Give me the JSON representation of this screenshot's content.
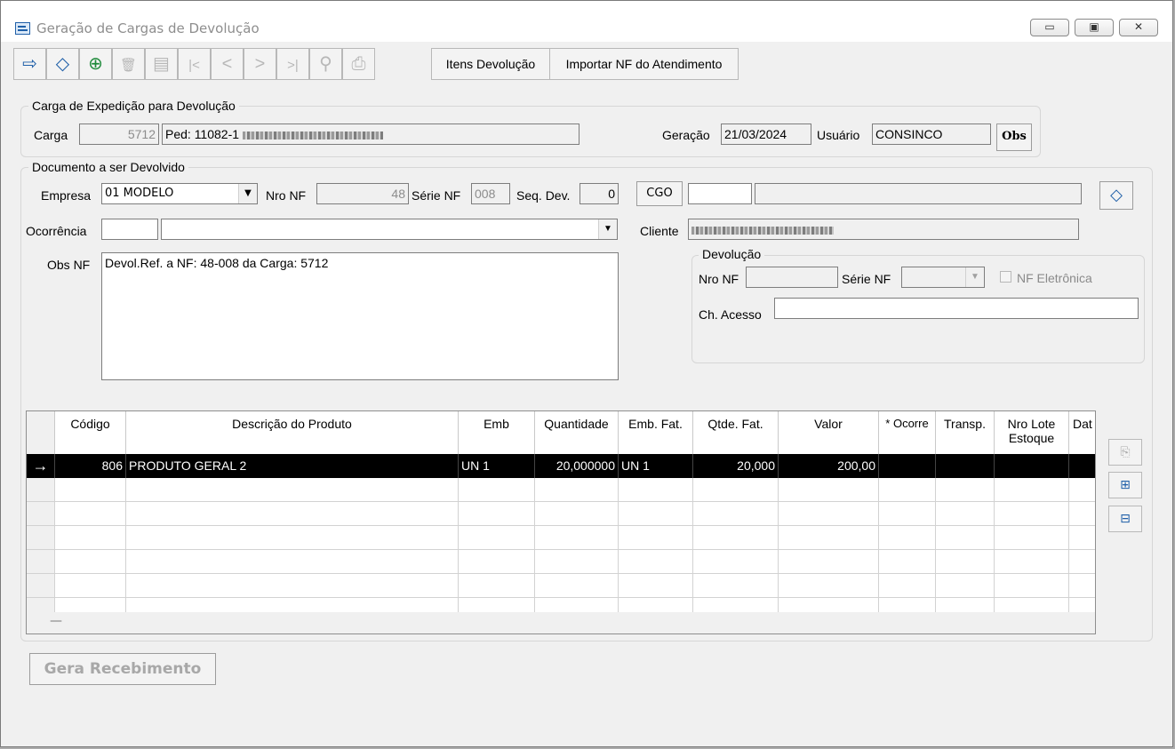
{
  "window": {
    "title": "Geração de Cargas de Devolução",
    "controls": [
      "▭",
      "▣",
      "✕"
    ]
  },
  "toolbar": {
    "icons": [
      {
        "name": "exit-icon",
        "glyph": "⇨",
        "enabled": true,
        "color": "#1f5fa8"
      },
      {
        "name": "eraser-icon",
        "glyph": "◇",
        "enabled": true,
        "color": "#1f5fa8"
      },
      {
        "name": "add-icon",
        "glyph": "⊕",
        "enabled": true,
        "color": "#1e8a3a"
      },
      {
        "name": "delete-icon",
        "glyph": "🗑",
        "enabled": false,
        "color": "#b7b7b7"
      },
      {
        "name": "save-icon",
        "glyph": "▤",
        "enabled": false,
        "color": "#b7b7b7"
      },
      {
        "name": "first-icon",
        "glyph": "|<",
        "enabled": false,
        "color": "#b7b7b7"
      },
      {
        "name": "previous-icon",
        "glyph": "<",
        "enabled": false,
        "color": "#b7b7b7"
      },
      {
        "name": "next-icon",
        "glyph": ">",
        "enabled": false,
        "color": "#b7b7b7"
      },
      {
        "name": "last-icon",
        "glyph": ">|",
        "enabled": false,
        "color": "#b7b7b7"
      },
      {
        "name": "search-icon",
        "glyph": "⚲",
        "enabled": false,
        "color": "#b7b7b7"
      },
      {
        "name": "print-icon",
        "glyph": "⎙",
        "enabled": false,
        "color": "#b7b7b7"
      }
    ],
    "itens_label": "Itens Devolução",
    "importar_label": "Importar NF do Atendimento"
  },
  "carga_group": {
    "label": "Carga de Expedição para Devolução",
    "carga_label": "Carga",
    "carga_value": "5712",
    "ped_value": "Ped: 11082-1",
    "geracao_label": "Geração",
    "geracao_value": "21/03/2024",
    "usuario_label": "Usuário",
    "usuario_value": "CONSINCO",
    "obs_label": "Obs"
  },
  "documento_group": {
    "label": "Documento a ser Devolvido",
    "empresa_label": "Empresa",
    "empresa_value": "01 MODELO",
    "nronf_label": "Nro NF",
    "nronf_value": "48",
    "serie_label": "Série NF",
    "serie_value": "008",
    "seq_label": "Seq. Dev.",
    "seq_value": "0",
    "cgo_label": "CGO",
    "cgo_value": "",
    "ocorrencia_label": "Ocorrência",
    "cliente_label": "Cliente",
    "obsnf_label": "Obs NF",
    "obsnf_value": "Devol.Ref. a NF: 48-008 da Carga: 5712"
  },
  "devolucao_group": {
    "label": "Devolução",
    "nronf_label": "Nro NF",
    "serie_label": "Série NF",
    "nfe_label": "NF Eletrônica",
    "chave_label": "Ch. Acesso",
    "chave_value": ""
  },
  "grid": {
    "columns": [
      "Código",
      "Descrição do Produto",
      "Emb",
      "Quantidade",
      "Emb. Fat.",
      "Qtde. Fat.",
      "Valor",
      "* Ocorre",
      "Transp.",
      "Nro Lote Estoque",
      "Dat"
    ],
    "rows": [
      {
        "indicator": "→",
        "codigo": "806",
        "descricao": "PRODUTO GERAL 2",
        "emb": "UN 1",
        "quantidade": "20,000000",
        "emb_fat": "UN 1",
        "qtde_fat": "20,000",
        "valor": "200,00",
        "ocorre": "",
        "transp": "",
        "lote": "",
        "dat": ""
      }
    ],
    "footer_marker": "—"
  },
  "side_buttons": [
    {
      "name": "copy-icon",
      "glyph": "⎘"
    },
    {
      "name": "add-row-icon",
      "glyph": "⊞"
    },
    {
      "name": "remove-row-icon",
      "glyph": "⊟"
    }
  ],
  "gera_label": "Gera Recebimento"
}
